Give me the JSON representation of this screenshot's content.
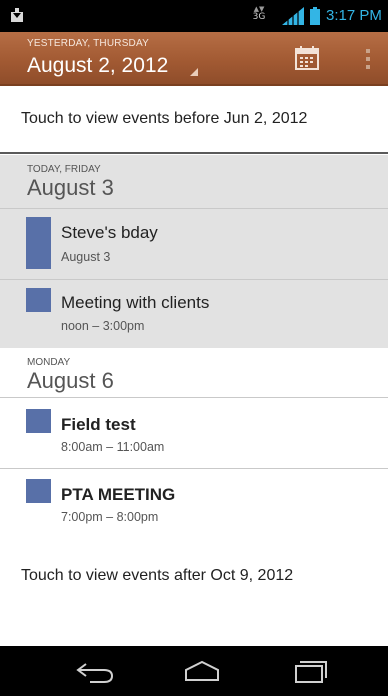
{
  "status_bar": {
    "network": "3G",
    "time": "3:17 PM"
  },
  "action_bar": {
    "subtitle": "YESTERDAY, THURSDAY",
    "title": "August 2, 2012"
  },
  "load_earlier": "Touch to view events before Jun 2, 2012",
  "days": [
    {
      "small_label": "TODAY, FRIDAY",
      "big_label": "August 3",
      "events": [
        {
          "title": "Steve's bday",
          "time": "August 3"
        },
        {
          "title": "Meeting with clients",
          "time": "noon – 3:00pm"
        }
      ]
    },
    {
      "small_label": "MONDAY",
      "big_label": "August 6",
      "events": [
        {
          "title": "Field test",
          "time": "8:00am – 11:00am"
        },
        {
          "title": "PTA MEETING",
          "time": "7:00pm – 8:00pm"
        }
      ]
    }
  ],
  "load_later": "Touch to view events after Oct 9, 2012",
  "colors": {
    "action_bar": "#a25a33",
    "event_color": "#5870a8",
    "today_background": "#e2e2e2",
    "status_accent": "#33b5e5"
  },
  "icons": {
    "status_left": "download-icon",
    "signal": "signal-icon",
    "battery": "battery-icon",
    "today": "calendar-today-icon",
    "overflow": "overflow-menu-icon",
    "back": "back-icon",
    "home": "home-icon",
    "recents": "recent-apps-icon"
  }
}
